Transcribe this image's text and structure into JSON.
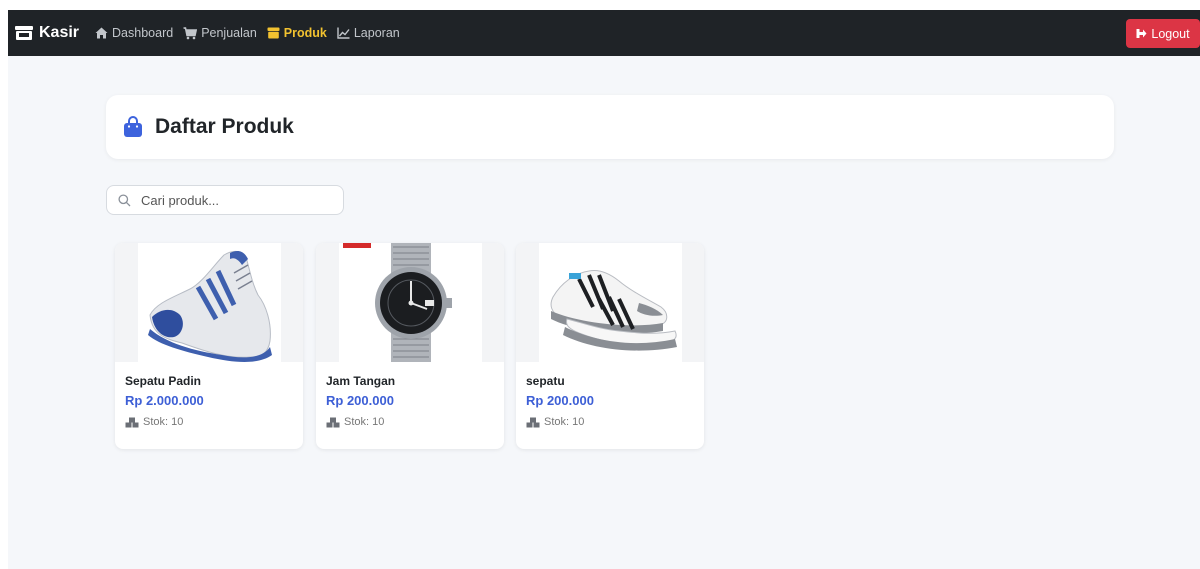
{
  "navbar": {
    "brand": "Kasir",
    "links": [
      {
        "label": "Dashboard",
        "icon": "home-icon"
      },
      {
        "label": "Penjualan",
        "icon": "cart-icon"
      },
      {
        "label": "Produk",
        "icon": "box-icon",
        "active": true
      },
      {
        "label": "Laporan",
        "icon": "chart-line-icon"
      }
    ],
    "logout_label": "Logout"
  },
  "header": {
    "title": "Daftar Produk",
    "icon": "shopping-bag-icon"
  },
  "search": {
    "placeholder": "Cari produk...",
    "value": ""
  },
  "products": [
    {
      "name": "Sepatu Padin",
      "price": "Rp 2.000.000",
      "stock": "Stok: 10",
      "image": "running-shoe-image"
    },
    {
      "name": "Jam Tangan",
      "price": "Rp 200.000",
      "stock": "Stok: 10",
      "image": "wristwatch-image"
    },
    {
      "name": "sepatu",
      "price": "Rp 200.000",
      "stock": "Stok: 10",
      "image": "sneaker-image"
    }
  ],
  "colors": {
    "navbar_bg": "#1f2327",
    "active_link": "#f2c230",
    "logout_bg": "#dc3545",
    "price": "#3d5fd6",
    "accent_icon": "#3d63dd"
  }
}
